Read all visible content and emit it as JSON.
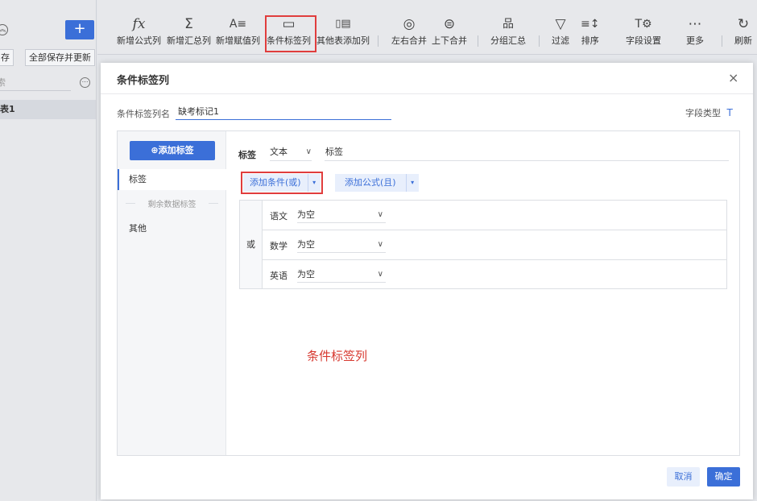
{
  "left_panel": {
    "circle_icon": "circle-chevron-icon",
    "plus_label": "+",
    "save_btn": "存",
    "save_all_btn": "全部保存并更新",
    "search_placeholder": "索",
    "more_icon": "more-icon",
    "table_item": "表1"
  },
  "toolbar": {
    "items": [
      {
        "icon": "fx",
        "label": "新增公式列"
      },
      {
        "icon": "Σ",
        "label": "新增汇总列"
      },
      {
        "icon": "A≡",
        "label": "新增赋值列"
      },
      {
        "icon": "▭",
        "label": "条件标签列"
      },
      {
        "icon": "▯▤",
        "label": "其他表添加列"
      },
      {
        "icon": "◎",
        "label": "左右合并"
      },
      {
        "icon": "⊜",
        "label": "上下合并"
      },
      {
        "icon": "品",
        "label": "分组汇总"
      },
      {
        "icon": "▽",
        "label": "过滤"
      },
      {
        "icon": "≡↕",
        "label": "排序"
      },
      {
        "icon": "T⚙",
        "label": "字段设置"
      },
      {
        "icon": "⋯",
        "label": "更多"
      },
      {
        "icon": "↻",
        "label": "刷新"
      }
    ],
    "highlight_color": "#e03d3d"
  },
  "dialog": {
    "title": "条件标签列",
    "close_icon": "×",
    "name_label": "条件标签列名",
    "name_value": "缺考标记1",
    "field_type_label": "字段类型",
    "field_type_icon": "T",
    "add_label_button": "⊕添加标签",
    "side_items": {
      "active": "标签",
      "divider": "剩余数据标签",
      "other": "其他"
    },
    "tag_label": "标签",
    "type_value": "文本",
    "tag_name_value": "标签",
    "add_condition_or": "添加条件(或)",
    "add_formula_and": "添加公式(且)",
    "dropdown_icon": "▾",
    "or_label": "或",
    "conditions": [
      {
        "field": "语文",
        "op": "为空"
      },
      {
        "field": "数学",
        "op": "为空"
      },
      {
        "field": "英语",
        "op": "为空"
      }
    ],
    "annotation": "条件标签列",
    "cancel": "取消",
    "ok": "确定"
  },
  "colors": {
    "accent": "#3b6fd8",
    "annotation": "#d7382f"
  }
}
